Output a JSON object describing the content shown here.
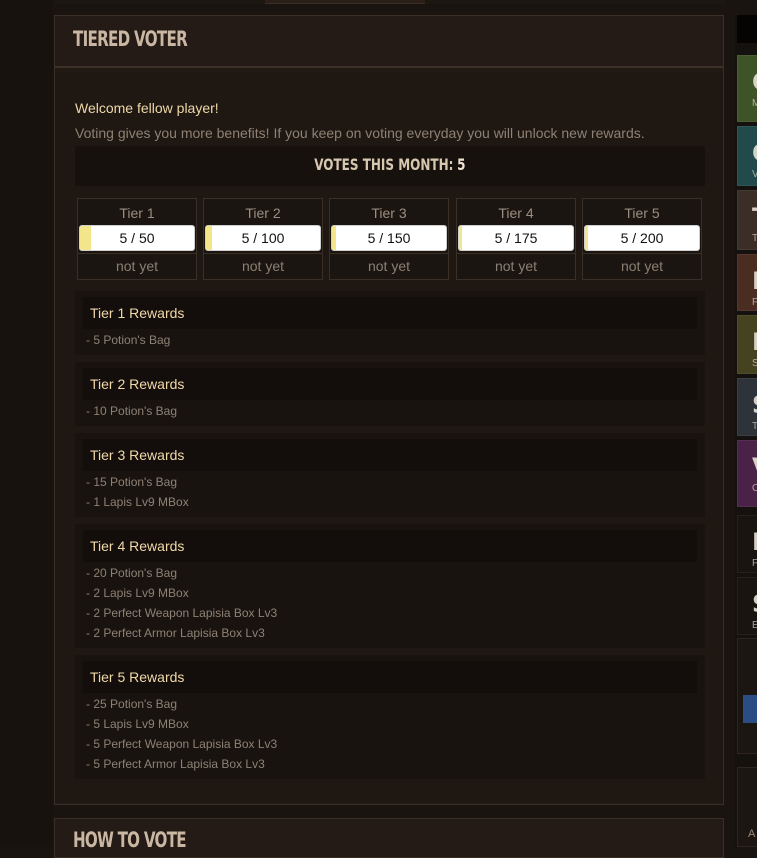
{
  "panel": {
    "title": "TIERED VOTER",
    "welcome": "Welcome fellow player!",
    "intro": "Voting gives you more benefits! If you keep on voting everyday you will unlock new rewards.",
    "votes_label": "VOTES THIS MONTH:",
    "votes_count": "5"
  },
  "tiers": [
    {
      "name": "Tier 1",
      "value": "5 / 50",
      "progress": 0.1,
      "status": "not yet"
    },
    {
      "name": "Tier 2",
      "value": "5 / 100",
      "progress": 0.05,
      "status": "not yet"
    },
    {
      "name": "Tier 3",
      "value": "5 / 150",
      "progress": 0.033,
      "status": "not yet"
    },
    {
      "name": "Tier 4",
      "value": "5 / 175",
      "progress": 0.029,
      "status": "not yet"
    },
    {
      "name": "Tier 5",
      "value": "5 / 200",
      "progress": 0.025,
      "status": "not yet"
    }
  ],
  "rewards": [
    {
      "title": "Tier 1 Rewards",
      "items": [
        "- 5 Potion's Bag"
      ]
    },
    {
      "title": "Tier 2 Rewards",
      "items": [
        "- 10 Potion's Bag"
      ]
    },
    {
      "title": "Tier 3 Rewards",
      "items": [
        "- 15 Potion's Bag",
        "- 1 Lapis Lv9 MBox"
      ]
    },
    {
      "title": "Tier 4 Rewards",
      "items": [
        "- 20 Potion's Bag",
        "- 2 Lapis Lv9 MBox",
        "- 2 Perfect Weapon Lapisia Box Lv3",
        "- 2 Perfect Armor Lapisia Box Lv3"
      ]
    },
    {
      "title": "Tier 5 Rewards",
      "items": [
        "- 25 Potion's Bag",
        "- 5 Lapis Lv9 MBox",
        "- 5 Perfect Weapon Lapisia Box Lv3",
        "- 5 Perfect Armor Lapisia Box Lv3"
      ]
    }
  ],
  "panel2": {
    "title": "HOW TO VOTE"
  },
  "right_sidebar": {
    "tiles": [
      {
        "letter": "C",
        "sub": "M",
        "color": "#3e5427"
      },
      {
        "letter": "C",
        "sub": "V",
        "color": "#234a4a"
      },
      {
        "letter": "T",
        "sub": "T",
        "color": "#3a2e26"
      },
      {
        "letter": "F",
        "sub": "F",
        "color": "#4a2c20"
      },
      {
        "letter": "F",
        "sub": "S",
        "color": "#45421f"
      },
      {
        "letter": "S",
        "sub": "T",
        "color": "#2e3339"
      },
      {
        "letter": "V",
        "sub": "C",
        "color": "#4a2248"
      },
      {
        "letter": "D",
        "sub": "F",
        "color": "#1a1410"
      },
      {
        "letter": "S",
        "sub": "E",
        "color": "#1a1410"
      }
    ],
    "footer_letter": "A"
  },
  "colors": {
    "accent_text": "#f0d8a8",
    "muted_text": "#8f8174",
    "progress_fill": "#f3e58a",
    "panel_bg": "#211914"
  }
}
